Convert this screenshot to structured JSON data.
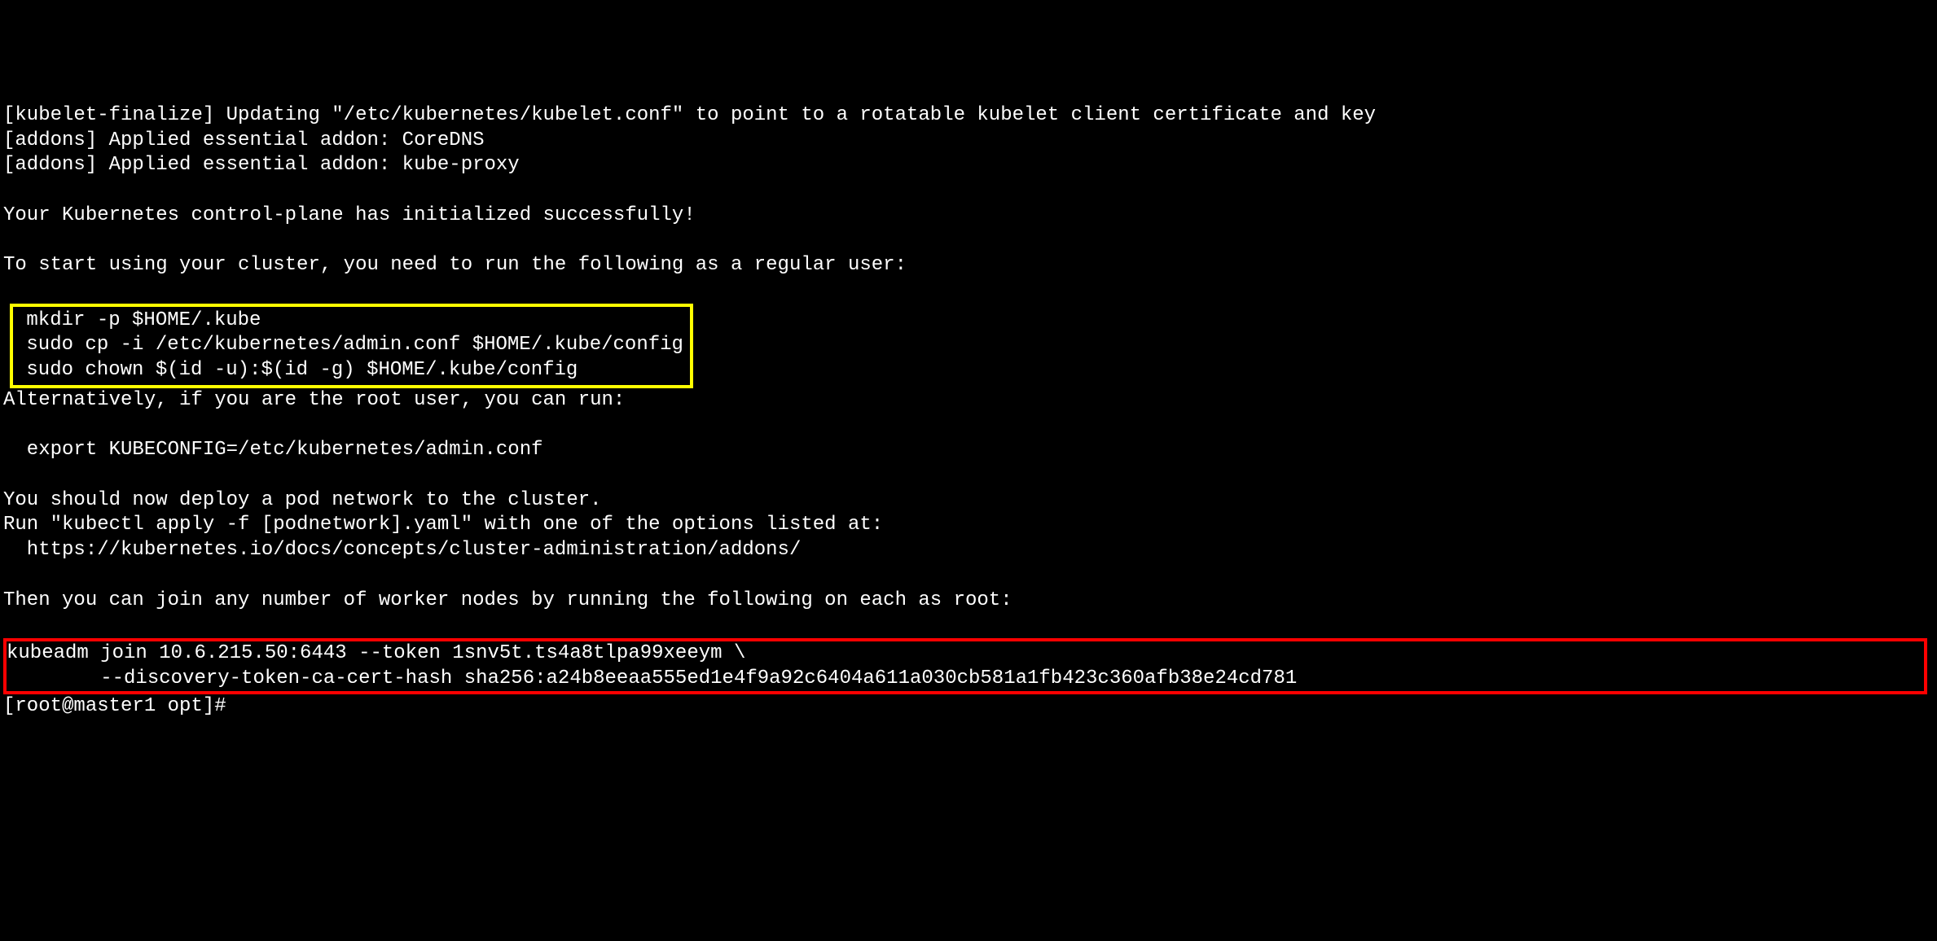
{
  "lines": {
    "kubelet_finalize": "[kubelet-finalize] Updating \"/etc/kubernetes/kubelet.conf\" to point to a rotatable kubelet client certificate and key",
    "addons_coredns": "[addons] Applied essential addon: CoreDNS",
    "addons_kubeproxy": "[addons] Applied essential addon: kube-proxy",
    "success": "Your Kubernetes control-plane has initialized successfully!",
    "start_cluster": "To start using your cluster, you need to run the following as a regular user:",
    "mkdir": " mkdir -p $HOME/.kube",
    "cp": " sudo cp -i /etc/kubernetes/admin.conf $HOME/.kube/config",
    "chown": " sudo chown $(id -u):$(id -g) $HOME/.kube/config",
    "alternatively": "Alternatively, if you are the root user, you can run:",
    "export": "  export KUBECONFIG=/etc/kubernetes/admin.conf",
    "deploy_pod": "You should now deploy a pod network to the cluster.",
    "run_kubectl": "Run \"kubectl apply -f [podnetwork].yaml\" with one of the options listed at:",
    "url": "  https://kubernetes.io/docs/concepts/cluster-administration/addons/",
    "join_nodes": "Then you can join any number of worker nodes by running the following on each as root:",
    "kubeadm_join1": "kubeadm join 10.6.215.50:6443 --token 1snv5t.ts4a8tlpa99xeeym \\",
    "kubeadm_join2": "        --discovery-token-ca-cert-hash sha256:a24b8eeaa555ed1e4f9a92c6404a611a030cb581a1fb423c360afb38e24cd781 ",
    "prompt": "[root@master1 opt]#"
  }
}
